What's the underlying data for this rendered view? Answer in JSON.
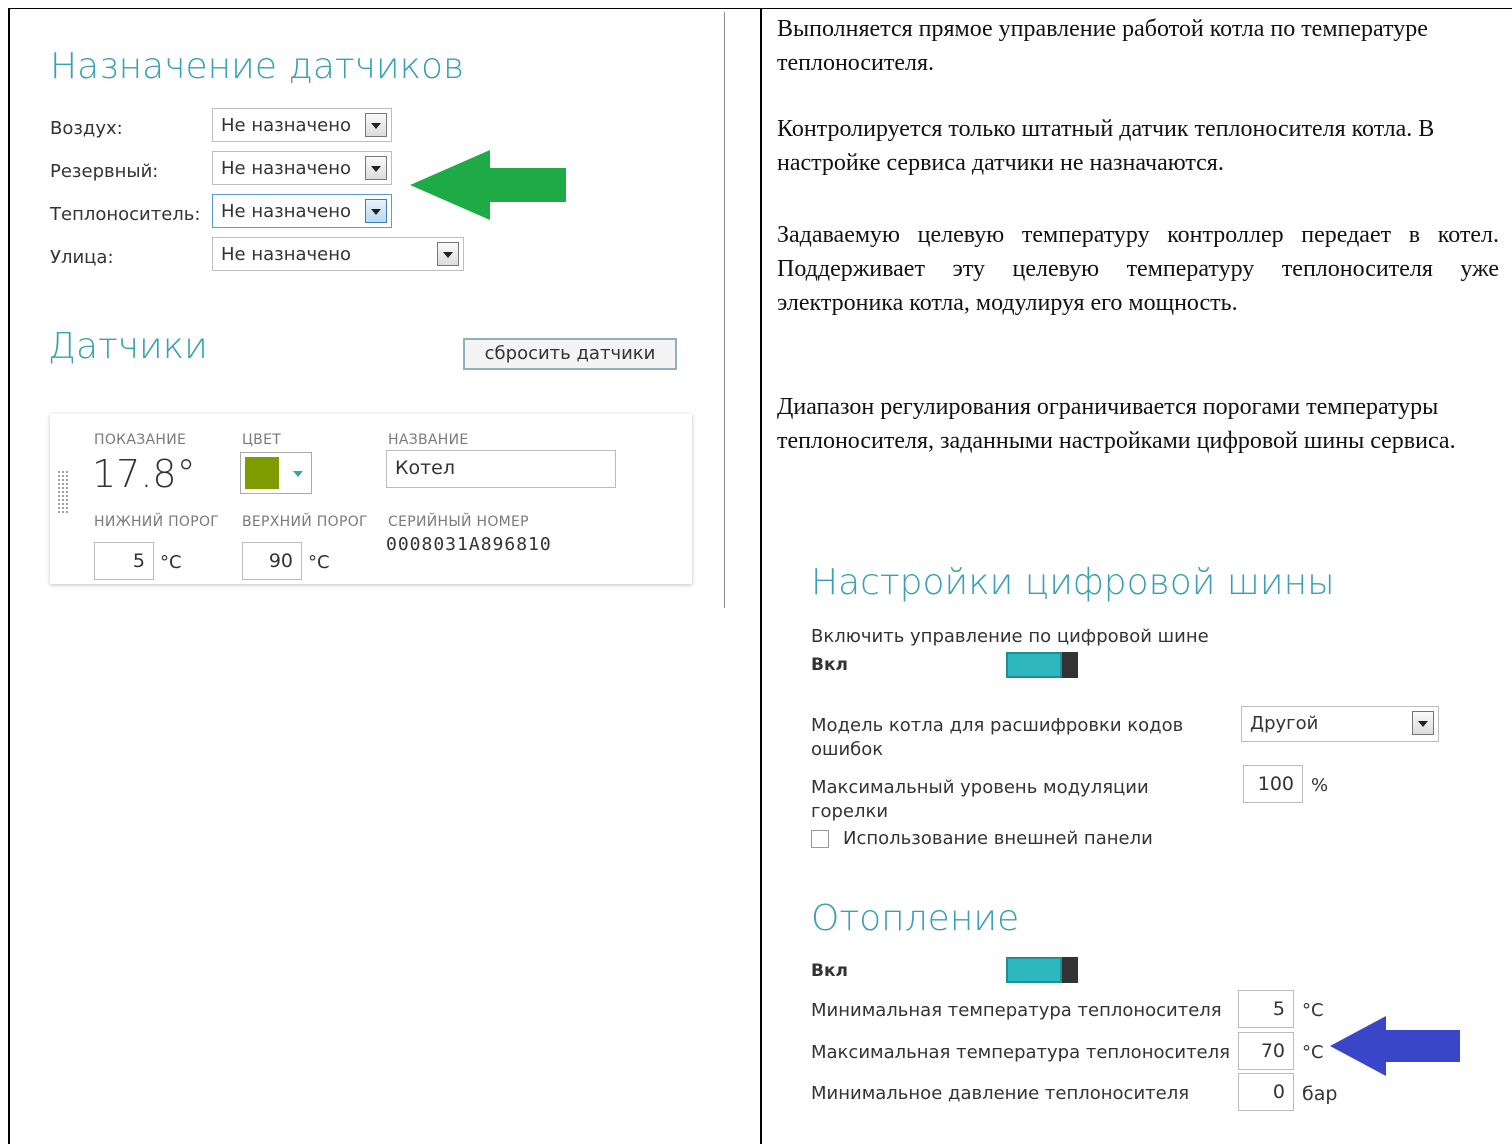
{
  "sensors_assign": {
    "title": "Назначение датчиков",
    "rows": [
      {
        "label": "Воздух:",
        "value": "Не назначено"
      },
      {
        "label": "Резервный:",
        "value": "Не назначено"
      },
      {
        "label": "Теплоноситель:",
        "value": "Не назначено"
      },
      {
        "label": "Улица:",
        "value": "Не назначено"
      }
    ]
  },
  "sensors": {
    "title": "Датчики",
    "reset_button": "сбросить датчики",
    "card": {
      "reading_caption": "ПОКАЗАНИЕ",
      "color_caption": "ЦВЕТ",
      "name_caption": "НАЗВАНИЕ",
      "reading": "17.8°",
      "name": "Котел",
      "low_caption": "НИЖНИЙ ПОРОГ",
      "high_caption": "ВЕРХНИЙ ПОРОГ",
      "serial_caption": "СЕРИЙНЫЙ НОМЕР",
      "low_value": "5",
      "high_value": "90",
      "unit": "°C",
      "serial": "0008031A896810",
      "color": "#7e9c00"
    }
  },
  "text": {
    "p1": "Выполняется прямое управление работой котла по температуре теплоносителя.",
    "p2": "Контролируется только штатный датчик теплоносителя котла. В настройке сервиса датчики не назначаются.",
    "p3": "Задаваемую целевую температуру контроллер передает в котел. Поддерживает эту целевую температуру теплоносителя уже электроника котла, модулируя его мощность.",
    "p4": "Диапазон регулирования ограничивается порогами температуры теплоносителя, заданными настройками цифровой шины сервиса."
  },
  "digital_bus": {
    "title": "Настройки цифровой шины",
    "enable_label": "Включить управление по цифровой шине",
    "enable_state": "Вкл",
    "enabled": true,
    "model_label": "Модель котла для расшифровки кодов ошибок",
    "model_value": "Другой",
    "modulation_label": "Максимальный уровень модуляции горелки",
    "modulation_value": "100",
    "modulation_unit": "%",
    "external_panel_label": "Использование внешней панели",
    "external_panel_checked": false
  },
  "heating": {
    "title": "Отопление",
    "state": "Вкл",
    "enabled": true,
    "min_temp_label": "Минимальная температура теплоносителя",
    "min_temp_value": "5",
    "max_temp_label": "Максимальная температура теплоносителя",
    "max_temp_value": "70",
    "temp_unit": "°C",
    "min_pressure_label": "Минимальное давление теплоносителя",
    "min_pressure_value": "0",
    "pressure_unit": "бар"
  },
  "colors": {
    "accent": "#3aa0b3",
    "toggle_on": "#2fb7c0",
    "green_arrow": "#1eab45",
    "blue_arrow": "#3a46c8"
  }
}
